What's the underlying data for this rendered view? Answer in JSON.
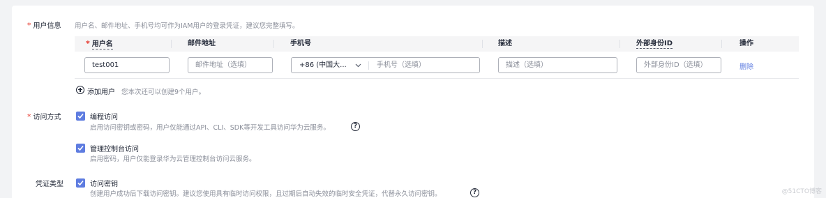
{
  "user_info": {
    "label": "用户信息",
    "hint": "用户名、邮件地址、手机号均可作为IAM用户的登录凭证，建议您完整填写。",
    "columns": [
      "用户名",
      "邮件地址",
      "手机号",
      "描述",
      "外部身份ID",
      "操作"
    ],
    "row": {
      "username": "test001",
      "email_placeholder": "邮件地址（选填）",
      "country_code": "+86 (中国大...",
      "phone_placeholder": "手机号（选填）",
      "description_placeholder": "描述（选填）",
      "external_id_placeholder": "外部身份ID（选填）",
      "delete": "删除"
    },
    "add_user": "添加用户",
    "add_user_hint": "您本次还可以创建9个用户。"
  },
  "access_mode": {
    "label": "访问方式",
    "options": [
      {
        "title": "编程访问",
        "desc": "启用访问密钥或密码，用户仅能通过API、CLI、SDK等开发工具访问华为云服务。",
        "checked": true
      },
      {
        "title": "管理控制台访问",
        "desc": "启用密码，用户仅能登录华为云管理控制台访问云服务。",
        "checked": true
      }
    ]
  },
  "credential_type": {
    "label": "凭证类型",
    "options": [
      {
        "title": "访问密钥",
        "desc": "创建用户成功后下载访问密钥。建议您使用具有临时访问权限，且过期后自动失效的临时安全凭证，代替永久访问密钥。",
        "checked": true
      }
    ]
  },
  "watermark": "@51CTO博客",
  "colors": {
    "accent": "#5e7ce0",
    "required": "#e6352a"
  }
}
